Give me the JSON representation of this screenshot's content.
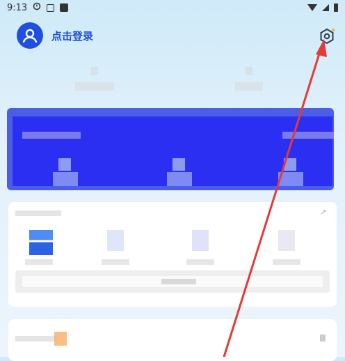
{
  "status_bar": {
    "time": "9:13",
    "icons": [
      "notification-icon",
      "a-box-icon",
      "app-square-icon",
      "wifi-icon",
      "signal-icon",
      "battery-icon"
    ]
  },
  "header": {
    "login_label": "点击登录",
    "avatar_icon": "user-icon",
    "settings_icon": "settings-hexagon-icon",
    "accent_color": "#1d4ed8"
  },
  "annotation": {
    "arrow_color": "#e53935",
    "points_to": "settings-button"
  }
}
